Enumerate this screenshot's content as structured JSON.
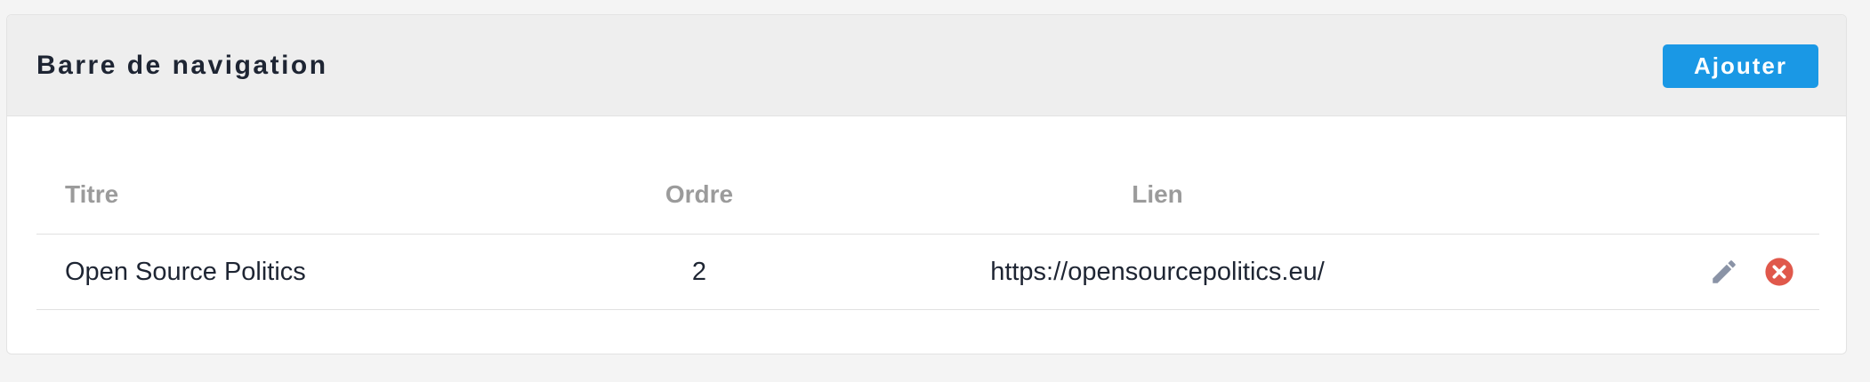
{
  "panel": {
    "title": "Barre de navigation",
    "add_label": "Ajouter"
  },
  "table": {
    "columns": {
      "title": "Titre",
      "order": "Ordre",
      "link": "Lien"
    },
    "rows": [
      {
        "title": "Open Source Politics",
        "order": "2",
        "link": "https://opensourcepolitics.eu/",
        "actions": [
          "pencil-icon",
          "delete-icon"
        ]
      }
    ]
  },
  "colors": {
    "accent": "#1a98e5",
    "edit_icon": "#8a93a6",
    "delete_icon": "#e0584b"
  }
}
